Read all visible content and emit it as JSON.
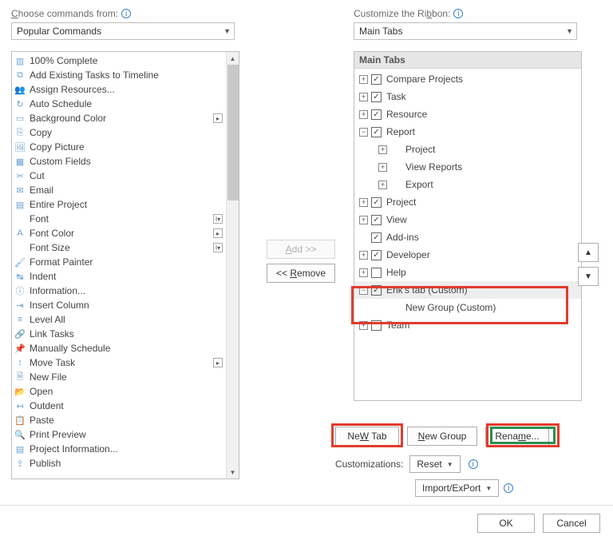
{
  "left": {
    "label_prefix": "Choose commands from:",
    "underline_char": "C",
    "combo_value": "Popular Commands",
    "commands": [
      {
        "icon": "▥",
        "label": "100% Complete"
      },
      {
        "icon": "⧉",
        "label": "Add Existing Tasks to Timeline"
      },
      {
        "icon": "👥",
        "label": "Assign Resources..."
      },
      {
        "icon": "↻",
        "label": "Auto Schedule"
      },
      {
        "icon": "▭",
        "label": "Background Color",
        "sub": "▸"
      },
      {
        "icon": "⎘",
        "label": "Copy"
      },
      {
        "icon": "🖼",
        "label": "Copy Picture"
      },
      {
        "icon": "▦",
        "label": "Custom Fields"
      },
      {
        "icon": "✂",
        "label": "Cut"
      },
      {
        "icon": "✉",
        "label": "Email"
      },
      {
        "icon": "▤",
        "label": "Entire Project"
      },
      {
        "icon": " ",
        "label": "Font",
        "sub": "I▾"
      },
      {
        "icon": "A",
        "label": "Font Color",
        "sub": "▸"
      },
      {
        "icon": " ",
        "label": "Font Size",
        "sub": "I▾"
      },
      {
        "icon": "🖌",
        "label": "Format Painter"
      },
      {
        "icon": "↹",
        "label": "Indent"
      },
      {
        "icon": "ⓘ",
        "label": "Information..."
      },
      {
        "icon": "⇥",
        "label": "Insert Column"
      },
      {
        "icon": "≡",
        "label": "Level All"
      },
      {
        "icon": "🔗",
        "label": "Link Tasks"
      },
      {
        "icon": "📌",
        "label": "Manually Schedule"
      },
      {
        "icon": "↕",
        "label": "Move Task",
        "sub": "▸"
      },
      {
        "icon": "🗎",
        "label": "New File"
      },
      {
        "icon": "📂",
        "label": "Open"
      },
      {
        "icon": "↤",
        "label": "Outdent"
      },
      {
        "icon": "📋",
        "label": "Paste"
      },
      {
        "icon": "🔍",
        "label": "Print Preview"
      },
      {
        "icon": "▤",
        "label": "Project Information..."
      },
      {
        "icon": "⇪",
        "label": "Publish"
      }
    ]
  },
  "middle": {
    "add_label": "Add >>",
    "remove_label": "<< Remove",
    "remove_u": "R"
  },
  "right": {
    "label": "Customize the Ribbon:",
    "label_u": "b",
    "combo_value": "Main Tabs",
    "tree_head": "Main Tabs",
    "nodes": [
      {
        "depth": 0,
        "exp": "+",
        "chk": true,
        "label": "Compare Projects"
      },
      {
        "depth": 0,
        "exp": "+",
        "chk": true,
        "label": "Task"
      },
      {
        "depth": 0,
        "exp": "+",
        "chk": true,
        "label": "Resource"
      },
      {
        "depth": 0,
        "exp": "-",
        "chk": true,
        "label": "Report"
      },
      {
        "depth": 1,
        "exp": "+",
        "label": "Project"
      },
      {
        "depth": 1,
        "exp": "+",
        "label": "View Reports"
      },
      {
        "depth": 1,
        "exp": "+",
        "label": "Export"
      },
      {
        "depth": 0,
        "exp": "+",
        "chk": true,
        "label": "Project"
      },
      {
        "depth": 0,
        "exp": "+",
        "chk": true,
        "label": "View"
      },
      {
        "depth": 0,
        "exp": "",
        "chk": true,
        "label": "Add-ins"
      },
      {
        "depth": 0,
        "exp": "+",
        "chk": true,
        "label": "Developer"
      },
      {
        "depth": 0,
        "exp": "+",
        "chk": false,
        "label": "Help"
      },
      {
        "depth": 0,
        "exp": "-",
        "chk": true,
        "label": "Erik's tab (Custom)",
        "selected": true
      },
      {
        "depth": 1,
        "exp": "",
        "label": "New Group (Custom)"
      },
      {
        "depth": 0,
        "exp": "+",
        "chk": false,
        "label": "Team"
      }
    ],
    "new_tab": "New Tab",
    "new_tab_u": "W",
    "new_group": "New Group",
    "new_group_u": "N",
    "rename": "Rename...",
    "rename_u": "m",
    "cust_label": "Customizations:",
    "reset": "Reset",
    "reset_u": "e",
    "import_export": "Import/Export",
    "import_u": "P"
  },
  "footer": {
    "ok": "OK",
    "cancel": "Cancel"
  }
}
